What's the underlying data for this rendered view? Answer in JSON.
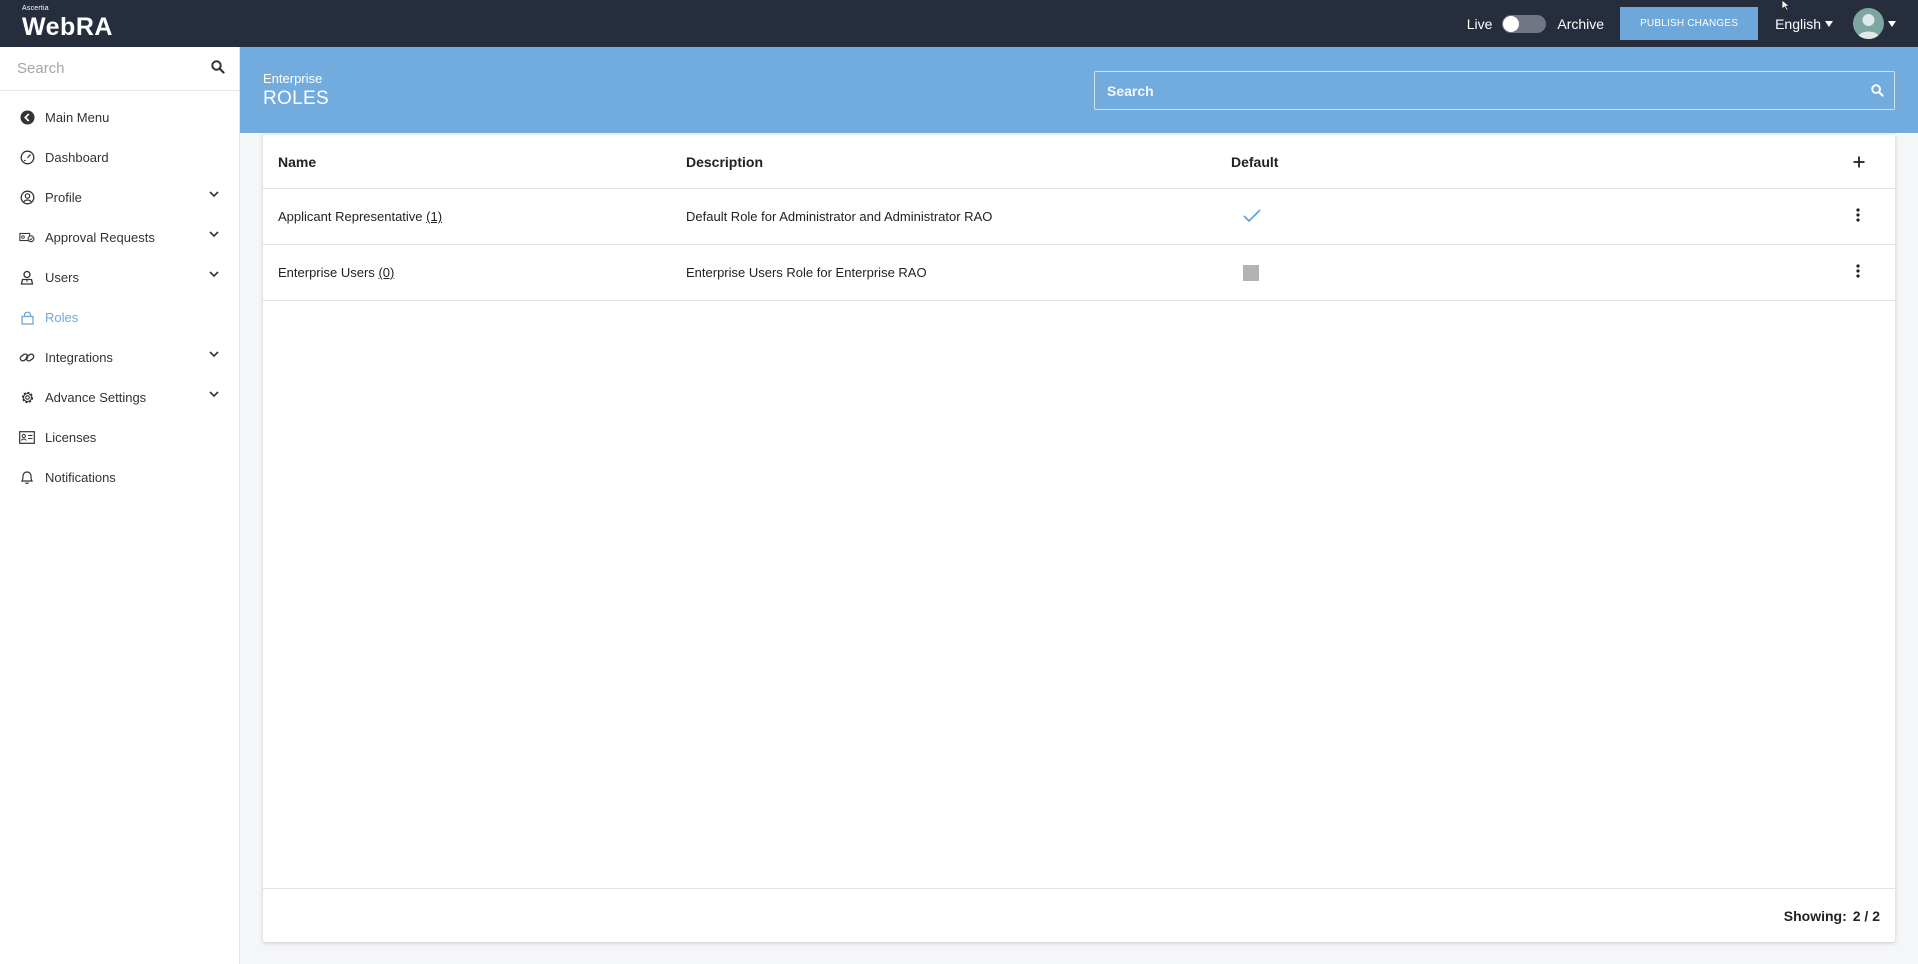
{
  "app": {
    "logo_brand": "Ascertia",
    "logo_name": "WebRA"
  },
  "topbar": {
    "live_label": "Live",
    "archive_label": "Archive",
    "publish_label": "PUBLISH CHANGES",
    "language": "English"
  },
  "sidebar": {
    "search_placeholder": "Search",
    "items": [
      {
        "label": "Main Menu",
        "icon": "back-circle-icon",
        "has_children": false,
        "active": false
      },
      {
        "label": "Dashboard",
        "icon": "gauge-icon",
        "has_children": false,
        "active": false
      },
      {
        "label": "Profile",
        "icon": "user-circle-icon",
        "has_children": true,
        "active": false
      },
      {
        "label": "Approval Requests",
        "icon": "approval-icon",
        "has_children": true,
        "active": false
      },
      {
        "label": "Users",
        "icon": "user-icon",
        "has_children": true,
        "active": false
      },
      {
        "label": "Roles",
        "icon": "lock-icon",
        "has_children": false,
        "active": true
      },
      {
        "label": "Integrations",
        "icon": "link-icon",
        "has_children": true,
        "active": false
      },
      {
        "label": "Advance Settings",
        "icon": "gear-icon",
        "has_children": true,
        "active": false
      },
      {
        "label": "Licenses",
        "icon": "id-card-icon",
        "has_children": false,
        "active": false
      },
      {
        "label": "Notifications",
        "icon": "bell-icon",
        "has_children": false,
        "active": false
      }
    ]
  },
  "header": {
    "breadcrumb": "Enterprise",
    "title": "ROLES",
    "search_placeholder": "Search"
  },
  "table": {
    "columns": {
      "name": "Name",
      "description": "Description",
      "default": "Default"
    },
    "rows": [
      {
        "name": "Applicant Representative",
        "count": "(1)",
        "description": "Default Role for Administrator and Administrator RAO",
        "default": true
      },
      {
        "name": "Enterprise Users",
        "count": "(0)",
        "description": "Enterprise Users Role for Enterprise RAO",
        "default": false
      }
    ],
    "showing_label": "Showing:",
    "showing_value": "2 / 2"
  },
  "colors": {
    "topbar": "#262d3d",
    "accent": "#72acde",
    "publish": "#6ea7d9",
    "active_nav": "#6ea7d9"
  }
}
